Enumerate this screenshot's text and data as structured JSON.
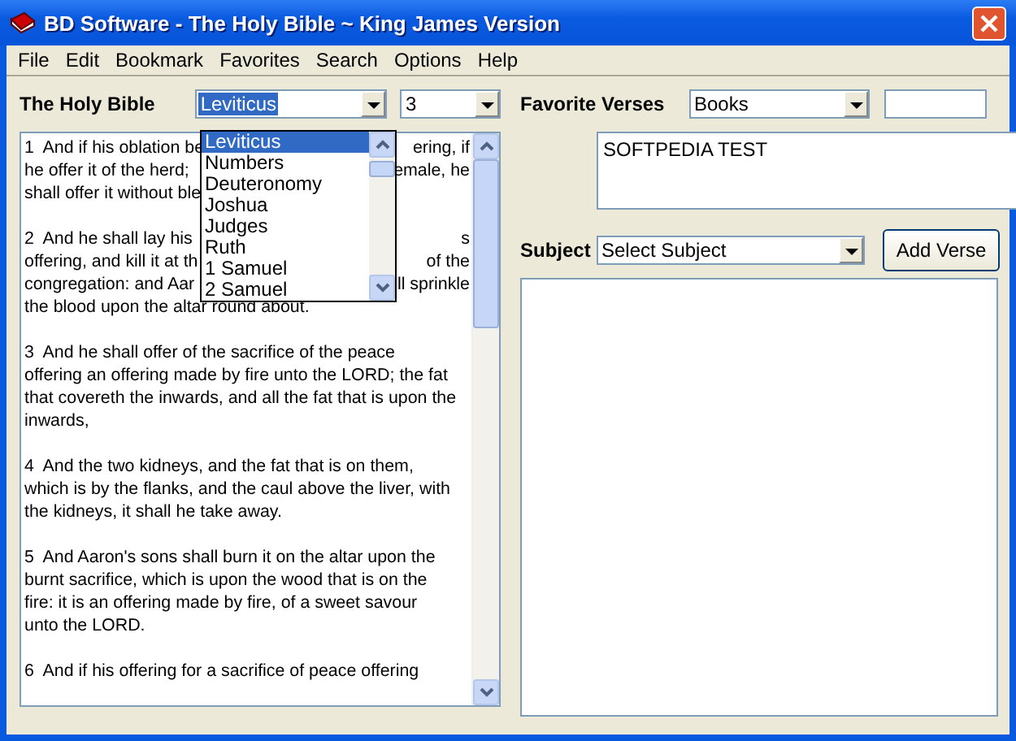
{
  "window": {
    "title": "BD Software - The Holy Bible ~ King James Version"
  },
  "menu": [
    "File",
    "Edit",
    "Bookmark",
    "Favorites",
    "Search",
    "Options",
    "Help"
  ],
  "bible": {
    "label": "The Holy Bible",
    "book": {
      "value": "Leviticus",
      "expanded": true,
      "options": [
        {
          "label": "Leviticus",
          "selected": true
        },
        {
          "label": "Numbers",
          "selected": false
        },
        {
          "label": "Deuteronomy",
          "selected": false
        },
        {
          "label": "Joshua",
          "selected": false
        },
        {
          "label": "Judges",
          "selected": false
        },
        {
          "label": "Ruth",
          "selected": false
        },
        {
          "label": "1 Samuel",
          "selected": false
        },
        {
          "label": "2 Samuel",
          "selected": false
        }
      ]
    },
    "chapter": {
      "value": "3"
    },
    "paragraphs": [
      {
        "lines": [
          {
            "left": "1  And if his oblation be",
            "right": "ering, if"
          },
          {
            "left": "he offer it of the herd;",
            "right": "emale, he"
          },
          {
            "left": "shall offer it without ble"
          }
        ]
      },
      {
        "lines": [
          {
            "left": "2  And he shall lay his",
            "right": "s"
          },
          {
            "left": "offering, and kill it at th",
            "right": "of the"
          },
          {
            "left": "congregation: and Aar",
            "right": "ll sprinkle"
          },
          {
            "left": "the blood upon the altar round about."
          }
        ]
      },
      {
        "lines": [
          {
            "left": "3  And he shall offer of the sacrifice of the peace"
          },
          {
            "left": "offering an offering made by fire unto the LORD; the fat"
          },
          {
            "left": "that covereth the inwards, and all the fat that is upon the"
          },
          {
            "left": "inwards,"
          }
        ]
      },
      {
        "lines": [
          {
            "left": "4  And the two kidneys, and the fat that is on them,"
          },
          {
            "left": "which is by the flanks, and the caul above the liver, with"
          },
          {
            "left": "the kidneys, it shall he take away."
          }
        ]
      },
      {
        "lines": [
          {
            "left": "5  And Aaron's sons shall burn it on the altar upon the"
          },
          {
            "left": "burnt sacrifice, which is upon the wood that is on the"
          },
          {
            "left": "fire: it is an offering made by fire, of a sweet savour"
          },
          {
            "left": "unto the LORD."
          }
        ]
      },
      {
        "lines": [
          {
            "left": "6  And if his offering for a sacrifice of peace offering"
          }
        ]
      }
    ]
  },
  "favorites": {
    "label": "Favorite Verses",
    "books": {
      "value": "Books"
    },
    "note": "SOFTPEDIA TEST",
    "subject_label": "Subject",
    "subject": {
      "value": "Select Subject"
    },
    "add_button": "Add Verse"
  }
}
